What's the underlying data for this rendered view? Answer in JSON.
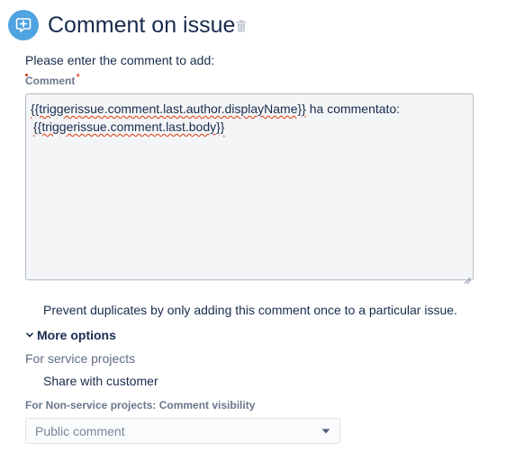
{
  "header": {
    "title": "Comment on issue",
    "icon": "comment-add-icon",
    "delete_icon": "trash-icon",
    "icon_color": "#4fa3e0"
  },
  "form": {
    "prompt": "Please enter the comment to add:",
    "comment_label": "Comment",
    "required_marker": "*",
    "comment_lines": [
      {
        "underlined": "{{triggerissue.comment.last.author.displayName}}",
        "plain": " ha commentato:"
      },
      {
        "underlined": "{{triggerissue.comment.last.body}}",
        "plain": ""
      }
    ],
    "prevent_duplicates_label": "Prevent duplicates by only adding this comment once to a particular issue.",
    "more_options_label": "More options",
    "service_projects_heading": "For service projects",
    "share_with_customer_label": "Share with customer",
    "non_service_heading": "For Non-service projects: Comment visibility",
    "visibility_select": {
      "value": "Public comment"
    }
  },
  "colors": {
    "text": "#172b4d",
    "muted": "#6b778c",
    "required": "#de350b",
    "textarea_bg": "#f4f5f7"
  }
}
